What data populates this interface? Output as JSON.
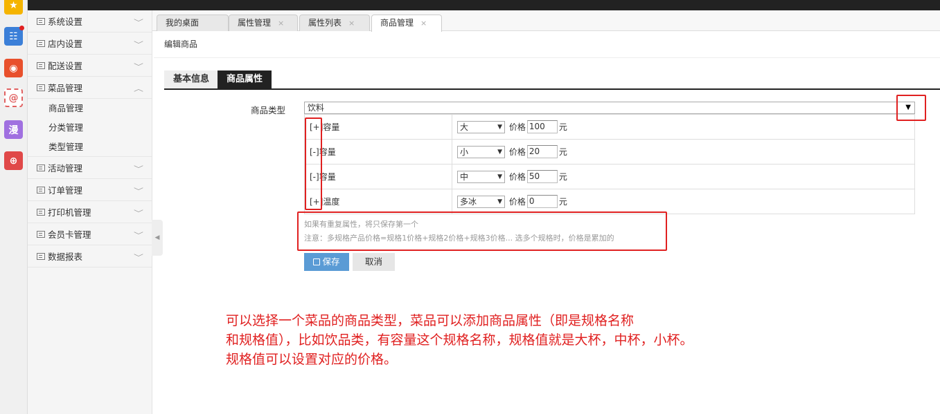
{
  "rail": {
    "apps": [
      {
        "icon": "star-app-icon",
        "glyph": "★",
        "color": "#f5b400"
      },
      {
        "icon": "calendar-app-icon",
        "glyph": "☷",
        "color": "#3b7fd8",
        "badge": true
      },
      {
        "icon": "weibo-app-icon",
        "glyph": "◉",
        "color": "#e8502c"
      },
      {
        "icon": "mail-app-icon",
        "glyph": "@",
        "color": "#e06060"
      },
      {
        "icon": "manga-app-icon",
        "glyph": "漫",
        "color": "#a070e0"
      },
      {
        "icon": "game-app-icon",
        "glyph": "⊕",
        "color": "#e04848"
      }
    ]
  },
  "sidebar": {
    "items": [
      {
        "label": "系统设置",
        "chevron": "﹀"
      },
      {
        "label": "店内设置",
        "chevron": "﹀"
      },
      {
        "label": "配送设置",
        "chevron": "﹀"
      },
      {
        "label": "菜品管理",
        "chevron": "︿"
      },
      {
        "label": "活动管理",
        "chevron": "﹀"
      },
      {
        "label": "订单管理",
        "chevron": "﹀"
      },
      {
        "label": "打印机管理",
        "chevron": "﹀"
      },
      {
        "label": "会员卡管理",
        "chevron": "﹀"
      },
      {
        "label": "数据报表",
        "chevron": "﹀"
      }
    ],
    "sub_items": [
      "商品管理",
      "分类管理",
      "类型管理"
    ],
    "collapse_glyph": "◀"
  },
  "tabs": [
    {
      "label": "我的桌面",
      "closable": false
    },
    {
      "label": "属性管理",
      "closable": true
    },
    {
      "label": "属性列表",
      "closable": true
    },
    {
      "label": "商品管理",
      "closable": true
    }
  ],
  "close_glyph": "×",
  "breadcrumb": "编辑商品",
  "content_tabs": [
    "基本信息",
    "商品属性"
  ],
  "form": {
    "type_label": "商品类型",
    "type_value": "饮料",
    "dropdown_glyph": "▼",
    "price_label": "价格",
    "unit": "元",
    "rows": [
      {
        "name": "[+]容量",
        "option": "大",
        "price": "100"
      },
      {
        "name": "[-]容量",
        "option": "小",
        "price": "20"
      },
      {
        "name": "[-]容量",
        "option": "中",
        "price": "50"
      },
      {
        "name": "[+]温度",
        "option": "多冰",
        "price": "0"
      }
    ],
    "hint1": "如果有重复属性，将只保存第一个",
    "hint2": "注意：多规格产品价格=规格1价格+规格2价格+规格3价格... 选多个规格时，价格是累加的",
    "save_label": "保存",
    "cancel_label": "取消"
  },
  "annotation": {
    "line1": "可以选择一个菜品的商品类型，菜品可以添加商品属性（即是规格名称",
    "line2": "和规格值），比如饮品类，有容量这个规格名称，规格值就是大杯，中杯，小杯。",
    "line3": "规格值可以设置对应的价格。"
  },
  "colors": {
    "annotation": "#e02020",
    "primary": "#5a9bd5",
    "dark": "#222222"
  }
}
